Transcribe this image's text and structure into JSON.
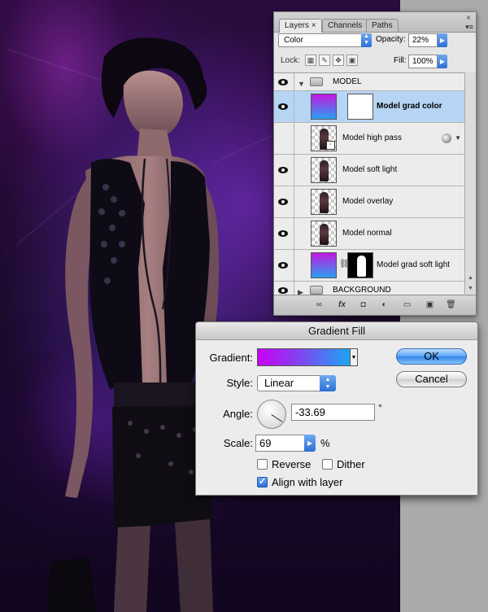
{
  "layers_panel": {
    "tabs": [
      {
        "label": "Layers",
        "close": "×"
      },
      {
        "label": "Channels"
      },
      {
        "label": "Paths"
      }
    ],
    "close_glyph": "×",
    "menu_glyph": "▾≡",
    "blend_mode": "Color",
    "opacity_label": "Opacity:",
    "opacity_value": "22%",
    "lock_label": "Lock:",
    "fill_label": "Fill:",
    "fill_value": "100%",
    "layers": [
      {
        "name": "MODEL",
        "kind": "group"
      },
      {
        "name": "Model grad color",
        "kind": "gradient-fill",
        "selected": true
      },
      {
        "name": "Model high pass",
        "kind": "smart-object",
        "has_effects": true
      },
      {
        "name": "Model soft light",
        "kind": "pixel"
      },
      {
        "name": "Model overlay",
        "kind": "pixel"
      },
      {
        "name": "Model normal",
        "kind": "pixel"
      },
      {
        "name": "Model grad soft light",
        "kind": "gradient-fill-masked"
      },
      {
        "name": "BACKGROUND",
        "kind": "group"
      }
    ],
    "bottom_icons": [
      "link-icon",
      "fx-icon",
      "mask-icon",
      "adjustment-icon",
      "group-icon",
      "new-layer-icon",
      "trash-icon"
    ],
    "bottom_glyphs": [
      "∞",
      "fx",
      "◘",
      "◐",
      "▭",
      "▣",
      "🗑"
    ]
  },
  "gradient_fill_dialog": {
    "title": "Gradient Fill",
    "gradient_label": "Gradient:",
    "gradient_colors": [
      "#c800f2",
      "#1ca6f4"
    ],
    "style_label": "Style:",
    "style_value": "Linear",
    "angle_label": "Angle:",
    "angle_value": "-33.69",
    "degree_symbol": "°",
    "scale_label": "Scale:",
    "scale_value": "69",
    "percent_symbol": "%",
    "reverse_label": "Reverse",
    "reverse_checked": false,
    "dither_label": "Dither",
    "dither_checked": false,
    "align_label": "Align with layer",
    "align_checked": true,
    "ok_label": "OK",
    "cancel_label": "Cancel"
  }
}
